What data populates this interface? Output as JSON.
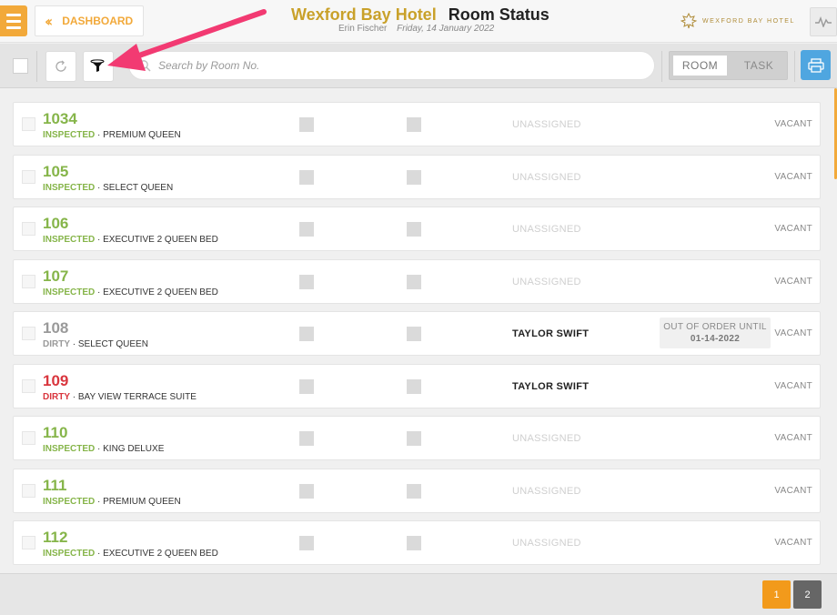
{
  "header": {
    "dashboard_label": "DASHBOARD",
    "hotel_name": "Wexford Bay Hotel",
    "page_title": "Room Status",
    "user_name": "Erin Fischer",
    "date": "Friday, 14 January 2022",
    "logo_text": "WEXFORD BAY HOTEL"
  },
  "toolbar": {
    "search_placeholder": "Search by Room No.",
    "view_room": "ROOM",
    "view_task": "TASK"
  },
  "rooms": [
    {
      "number": "1034",
      "status": "INSPECTED",
      "type": "PREMIUM QUEEN",
      "assignee": "UNASSIGNED",
      "occupancy": "VACANT",
      "status_color": "green",
      "assigned": false
    },
    {
      "number": "105",
      "status": "INSPECTED",
      "type": "SELECT QUEEN",
      "assignee": "UNASSIGNED",
      "occupancy": "VACANT",
      "status_color": "green",
      "assigned": false
    },
    {
      "number": "106",
      "status": "INSPECTED",
      "type": "EXECUTIVE 2 QUEEN BED",
      "assignee": "UNASSIGNED",
      "occupancy": "VACANT",
      "status_color": "green",
      "assigned": false
    },
    {
      "number": "107",
      "status": "INSPECTED",
      "type": "EXECUTIVE 2 QUEEN BED",
      "assignee": "UNASSIGNED",
      "occupancy": "VACANT",
      "status_color": "green",
      "assigned": false
    },
    {
      "number": "108",
      "status": "DIRTY",
      "type": "SELECT QUEEN",
      "assignee": "TAYLOR SWIFT",
      "occupancy": "VACANT",
      "status_color": "gray",
      "assigned": true,
      "out_of_order_label": "OUT OF ORDER UNTIL",
      "out_of_order_date": "01-14-2022"
    },
    {
      "number": "109",
      "status": "DIRTY",
      "type": "BAY VIEW TERRACE SUITE",
      "assignee": "TAYLOR SWIFT",
      "occupancy": "VACANT",
      "status_color": "red",
      "assigned": true
    },
    {
      "number": "110",
      "status": "INSPECTED",
      "type": "KING DELUXE",
      "assignee": "UNASSIGNED",
      "occupancy": "VACANT",
      "status_color": "green",
      "assigned": false
    },
    {
      "number": "111",
      "status": "INSPECTED",
      "type": "PREMIUM QUEEN",
      "assignee": "UNASSIGNED",
      "occupancy": "VACANT",
      "status_color": "green",
      "assigned": false
    },
    {
      "number": "112",
      "status": "INSPECTED",
      "type": "EXECUTIVE 2 QUEEN BED",
      "assignee": "UNASSIGNED",
      "occupancy": "VACANT",
      "status_color": "green",
      "assigned": false
    }
  ],
  "pagination": {
    "page_1": "1",
    "page_2": "2",
    "current": "1"
  },
  "colors": {
    "accent": "#f2a93a",
    "inspected": "#86b54a",
    "dirty_red": "#d9363e",
    "dirty_gray": "#9a9a9a",
    "print_blue": "#4fa6e0",
    "annotation_arrow": "#f23a72"
  }
}
